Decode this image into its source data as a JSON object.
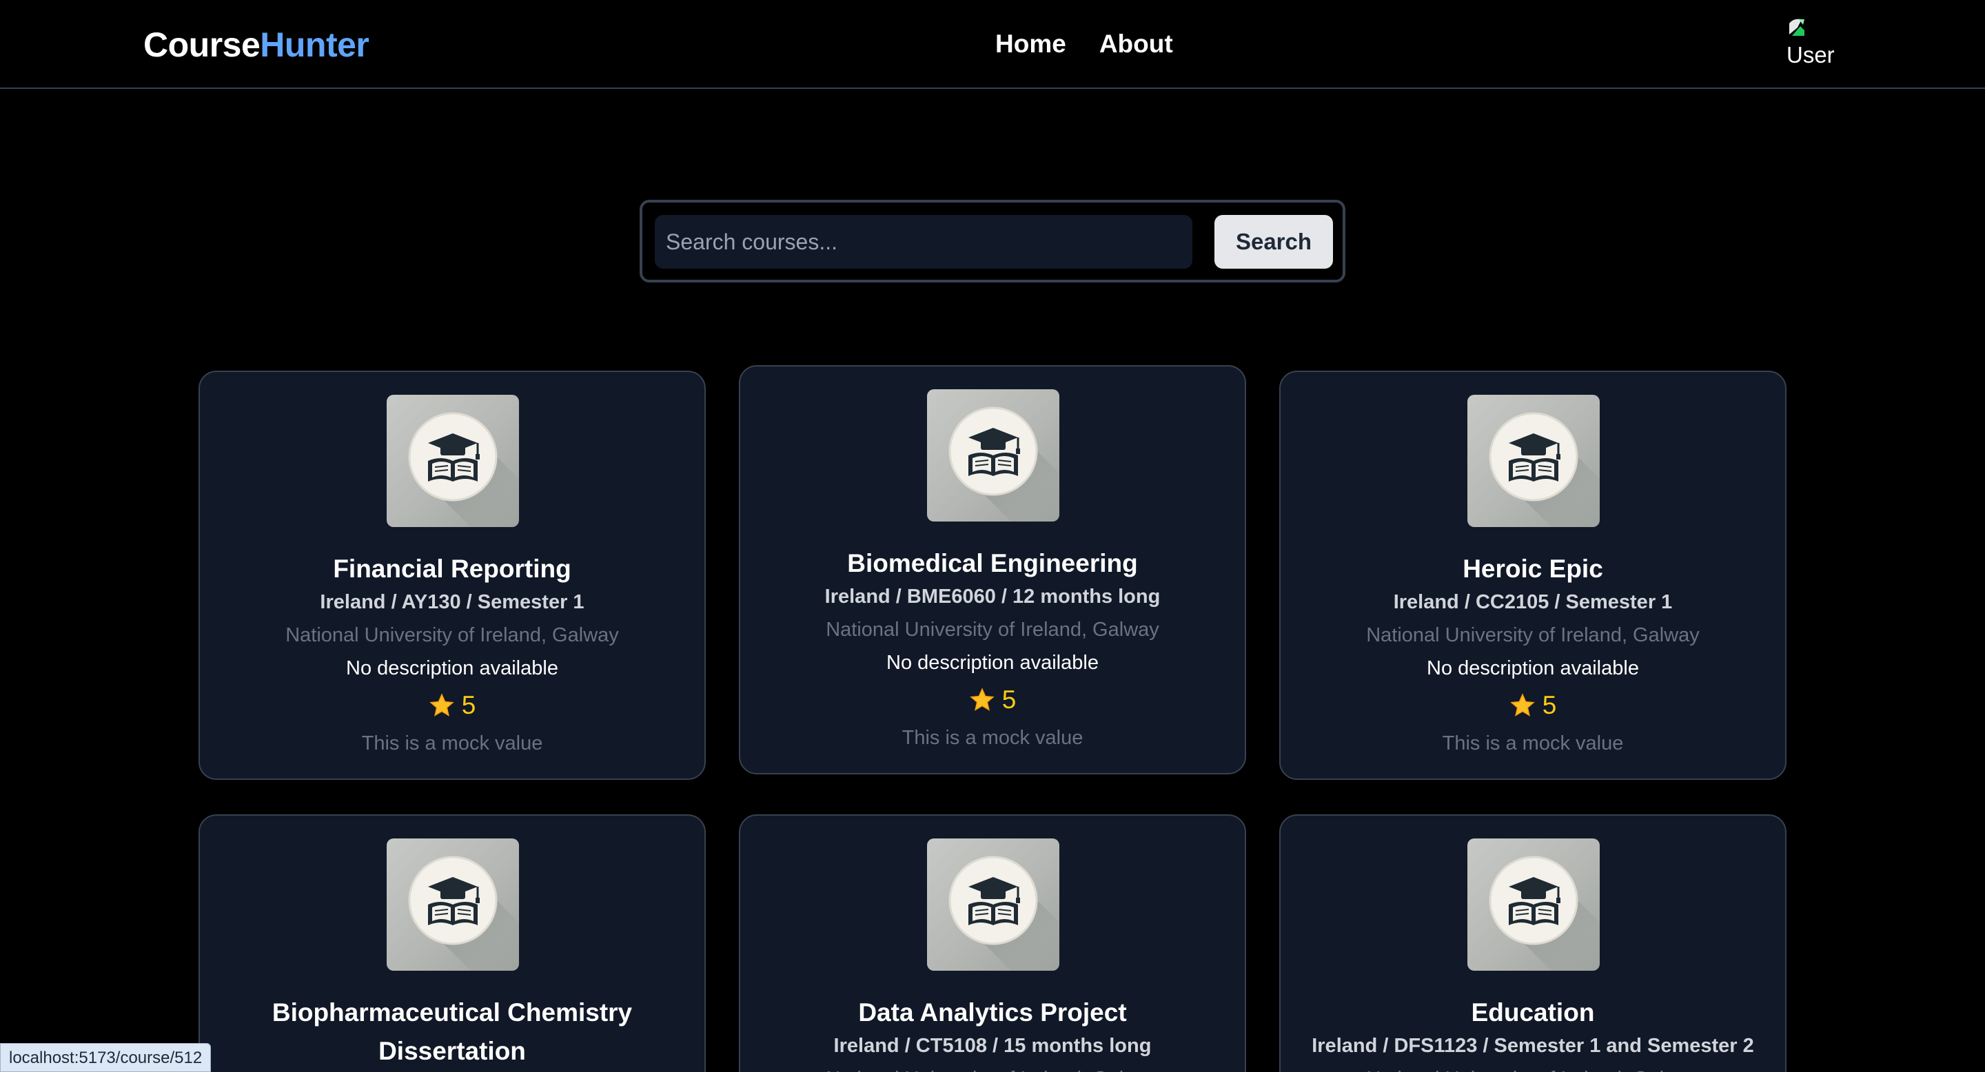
{
  "navbar": {
    "logo_part1": "Course",
    "logo_part2": "Hunter",
    "links": [
      {
        "label": "Home"
      },
      {
        "label": "About"
      }
    ],
    "avatar_alt": "User"
  },
  "search": {
    "placeholder": "Search courses...",
    "value": "",
    "button_label": "Search"
  },
  "courses": [
    {
      "title": "Financial Reporting",
      "meta": "Ireland / AY130 / Semester 1",
      "university": "National University of Ireland, Galway",
      "description": "No description available",
      "rating": "5",
      "note": "This is a mock value"
    },
    {
      "title": "Biomedical Engineering",
      "meta": "Ireland / BME6060 / 12 months long",
      "university": "National University of Ireland, Galway",
      "description": "No description available",
      "rating": "5",
      "note": "This is a mock value"
    },
    {
      "title": "Heroic Epic",
      "meta": "Ireland / CC2105 / Semester 1",
      "university": "National University of Ireland, Galway",
      "description": "No description available",
      "rating": "5",
      "note": "This is a mock value"
    },
    {
      "title": "Biopharmaceutical Chemistry Dissertation",
      "meta": "",
      "university": "",
      "description": "",
      "rating": "",
      "note": ""
    },
    {
      "title": "Data Analytics Project",
      "meta": "Ireland / CT5108 / 15 months long",
      "university": "National University of Ireland, Galway",
      "description": "",
      "rating": "",
      "note": ""
    },
    {
      "title": "Education",
      "meta": "Ireland / DFS1123 / Semester 1 and Semester 2",
      "university": "National University of Ireland, Galway",
      "description": "",
      "rating": "",
      "note": ""
    }
  ],
  "status_bar": {
    "url": "localhost:5173/course/512"
  },
  "colors": {
    "accent": "#60a5fa",
    "card_bg": "#111827",
    "star": "#facc15"
  },
  "icons": {
    "course_thumbnail": "graduation-cap-book-icon",
    "rating": "star-icon"
  }
}
